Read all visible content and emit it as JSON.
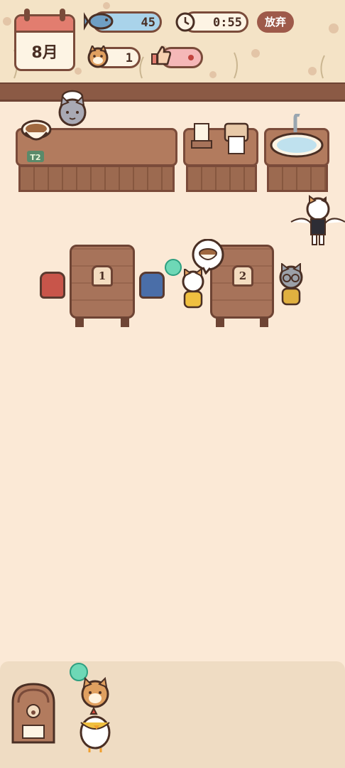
{
  "hud": {
    "month": "8月",
    "fish_count": "45",
    "timer": "0:55",
    "give_up_label": "放弃",
    "customer_count": "1"
  },
  "kitchen": {
    "order_tag": "T2"
  },
  "tables": [
    {
      "number": "1"
    },
    {
      "number": "2"
    }
  ],
  "colors": {
    "accent_brown": "#7a4b3a",
    "fish_bar": "#a9d3ea",
    "like_bar": "#f5b8b8",
    "smiley": "#6ed8b6",
    "floor": "#fbe9d6"
  }
}
